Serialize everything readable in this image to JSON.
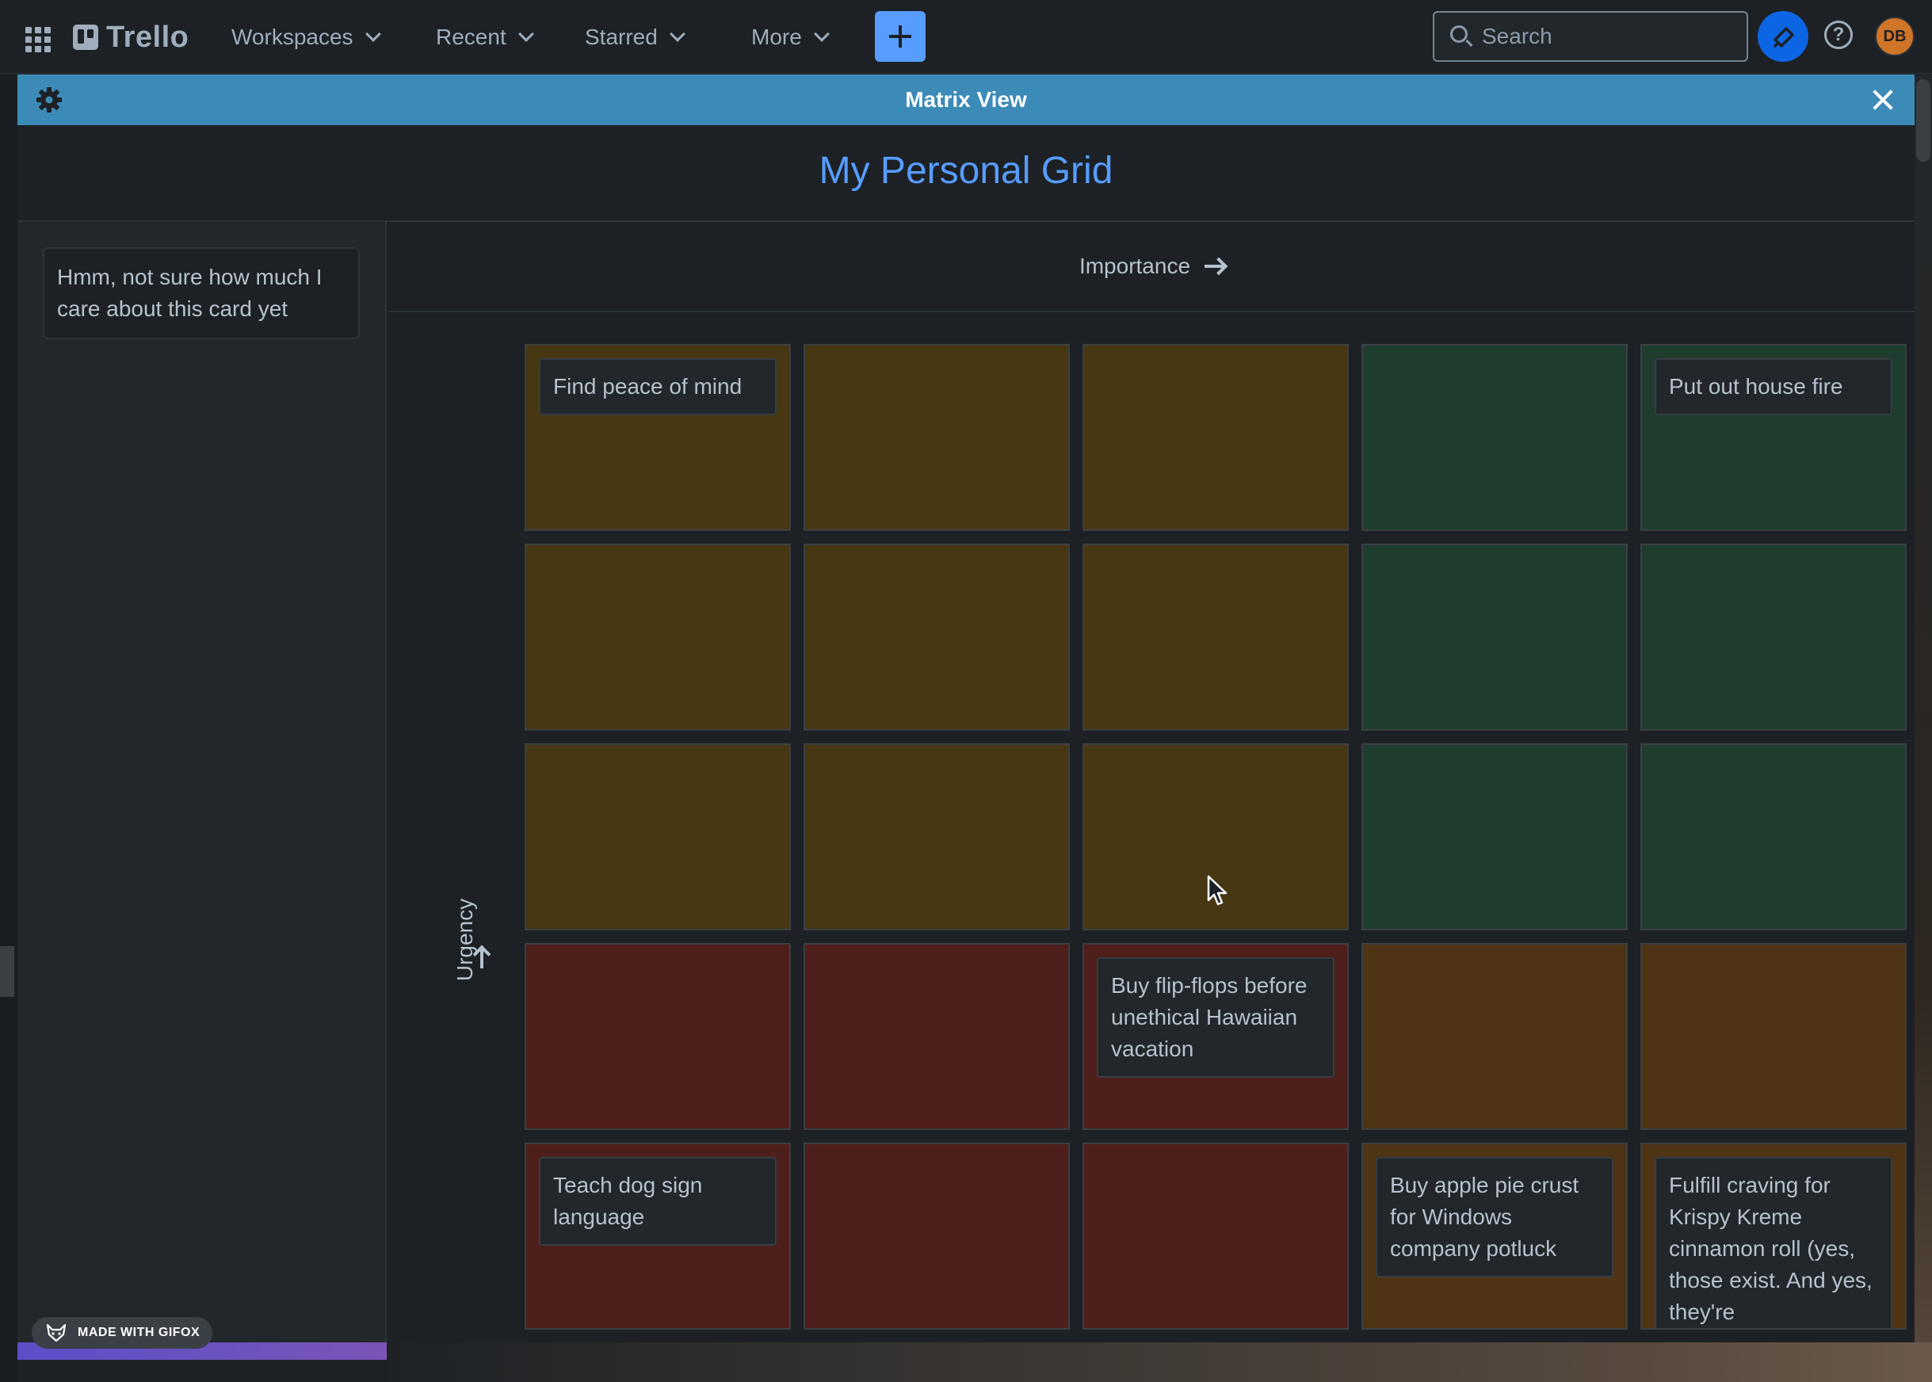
{
  "nav": {
    "logo": "Trello",
    "menus": [
      {
        "label": "Workspaces"
      },
      {
        "label": "Recent"
      },
      {
        "label": "Starred"
      },
      {
        "label": "More"
      }
    ],
    "search_placeholder": "Search",
    "avatar_initials": "DB"
  },
  "modal": {
    "header_title": "Matrix View",
    "board_title": "My Personal Grid",
    "unsorted_card": "Hmm, not sure how much I care about this card yet",
    "x_axis_label": "Importance",
    "y_axis_label": "Urgency"
  },
  "matrix": {
    "rows": [
      [
        {
          "color": "yellow",
          "card": "Find peace of mind"
        },
        {
          "color": "yellow",
          "card": ""
        },
        {
          "color": "yellow",
          "card": ""
        },
        {
          "color": "green",
          "card": ""
        },
        {
          "color": "green",
          "card": "Put out house fire"
        }
      ],
      [
        {
          "color": "yellow",
          "card": ""
        },
        {
          "color": "yellow",
          "card": ""
        },
        {
          "color": "yellow",
          "card": ""
        },
        {
          "color": "green",
          "card": ""
        },
        {
          "color": "green",
          "card": ""
        }
      ],
      [
        {
          "color": "yellow",
          "card": ""
        },
        {
          "color": "yellow",
          "card": ""
        },
        {
          "color": "yellow",
          "card": ""
        },
        {
          "color": "green",
          "card": ""
        },
        {
          "color": "green",
          "card": ""
        }
      ],
      [
        {
          "color": "red",
          "card": ""
        },
        {
          "color": "red",
          "card": ""
        },
        {
          "color": "red",
          "card": "Buy flip-flops before unethical Hawaiian vacation"
        },
        {
          "color": "orange",
          "card": ""
        },
        {
          "color": "orange",
          "card": ""
        }
      ],
      [
        {
          "color": "red",
          "card": "Teach dog sign language"
        },
        {
          "color": "red",
          "card": ""
        },
        {
          "color": "red",
          "card": ""
        },
        {
          "color": "orange",
          "card": "Buy apple pie crust for Windows company potluck"
        },
        {
          "color": "orange",
          "card": "Fulfill craving for Krispy Kreme cinnamon roll (yes, those exist. And yes, they're"
        }
      ]
    ]
  },
  "colors": {
    "header_blue": "#3c8ab8",
    "title_blue": "#579dff",
    "cell_yellow": "#473713",
    "cell_green": "#1f3d2e",
    "cell_red": "#4f1f1b",
    "cell_orange": "#4e3314"
  },
  "watermark": "MADE WITH GIFOX"
}
